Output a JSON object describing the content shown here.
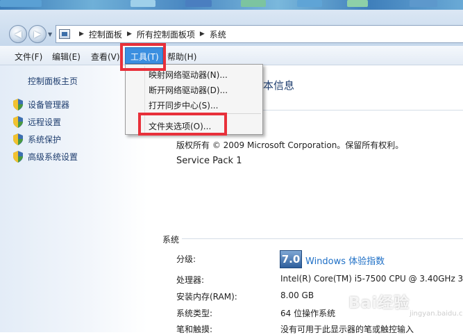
{
  "address": {
    "crumbs": [
      "控制面板",
      "所有控制面板项",
      "系统"
    ]
  },
  "menubar": {
    "file": "文件(F)",
    "edit": "编辑(E)",
    "view": "查看(V)",
    "tools": "工具(T)",
    "help": "帮助(H)"
  },
  "tools_menu": {
    "items": [
      "映射网络驱动器(N)...",
      "断开网络驱动器(D)...",
      "打开同步中心(S)...",
      "文件夹选项(O)..."
    ]
  },
  "sidebar": {
    "home": "控制面板主页",
    "links": [
      "设备管理器",
      "远程设置",
      "系统保护",
      "高级系统设置"
    ]
  },
  "main": {
    "heading_fragment": "本信息",
    "copyright": "版权所有 © 2009 Microsoft Corporation。保留所有权利。",
    "service_pack": "Service Pack 1",
    "section_title": "系统",
    "rating_label": "分级:",
    "rating_score": "7.0",
    "rating_link": "Windows 体验指数",
    "rows": [
      {
        "label": "处理器:",
        "value": "Intel(R) Core(TM) i5-7500 CPU @ 3.40GHz   3"
      },
      {
        "label": "安装内存(RAM):",
        "value": "8.00 GB"
      },
      {
        "label": "系统类型:",
        "value": "64 位操作系统"
      },
      {
        "label": "笔和触摸:",
        "value": "没有可用于此显示器的笔或触控输入"
      }
    ]
  },
  "watermark": {
    "brand": "Bai经验",
    "sub": "jingyan.baidu.com"
  },
  "colors": {
    "highlight": "#e8303a",
    "menu_active": "#3b8fe0",
    "link": "#1e6fc6"
  }
}
